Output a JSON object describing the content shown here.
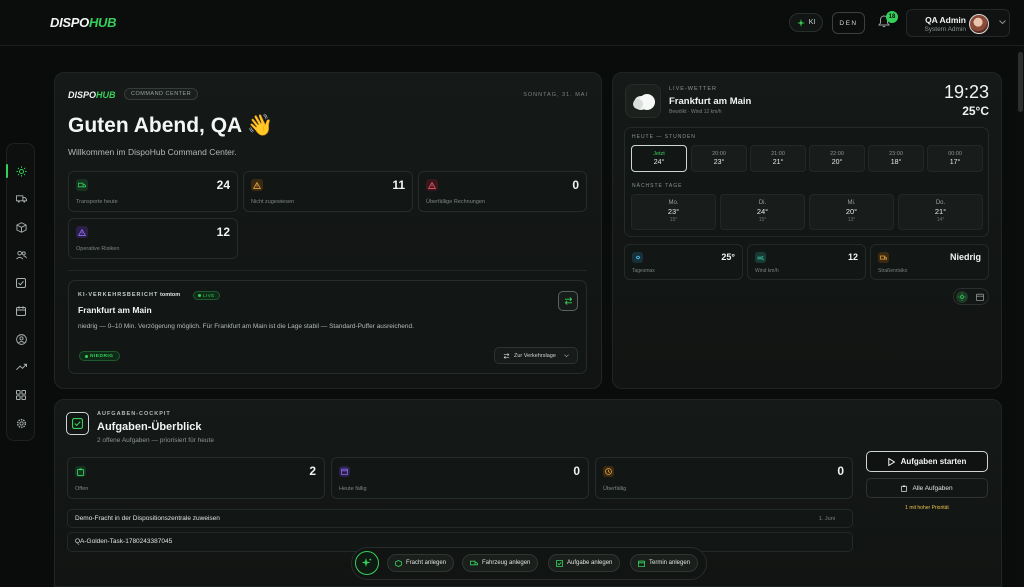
{
  "app": {
    "logo_a": "DISPO",
    "logo_b": "HUB"
  },
  "topbar": {
    "ki_label": "KI",
    "lang_label": "DEN",
    "notif_count": "18",
    "user_name": "QA Admin",
    "user_role": "System Admin"
  },
  "command_center": {
    "logo_a": "DISPO",
    "logo_b": "HUB",
    "badge": "COMMAND CENTER",
    "date": "SONNTAG, 31. MAI",
    "greeting": "Guten Abend, QA 👋",
    "welcome": "Willkommen im DispoHub Command Center.",
    "stats": [
      {
        "label": "Transporte heute",
        "value": "24",
        "icon": "truck-icon"
      },
      {
        "label": "Nicht zugewiesen",
        "value": "11",
        "icon": "warning-icon"
      },
      {
        "label": "Überfällige Rechnungen",
        "value": "0",
        "icon": "alert-icon"
      },
      {
        "label": "Operative Risiken",
        "value": "12",
        "icon": "risk-icon"
      }
    ],
    "traffic": {
      "heading": "KI-VERKEHRSBERICHT",
      "source": "tomtom",
      "live": "LIVE",
      "title": "Frankfurt am Main",
      "text": "niedrig — 0–10 Min. Verzögerung möglich. Für Frankfurt am Main ist die Lage stabil — Standard-Puffer ausreichend.",
      "level": "NIEDRIG",
      "link": "Zur Verkehrslage"
    }
  },
  "weather": {
    "tag": "LIVE-WETTER",
    "city": "Frankfurt am Main",
    "sub": "Bewölkt · Wind 12 km/h",
    "time": "19:23",
    "temp": "25°C",
    "hours_title": "HEUTE — STUNDEN",
    "hours": [
      {
        "t": "Jetzt",
        "v": "24°"
      },
      {
        "t": "20:00",
        "v": "23°"
      },
      {
        "t": "21:00",
        "v": "21°"
      },
      {
        "t": "22:00",
        "v": "20°"
      },
      {
        "t": "23:00",
        "v": "18°"
      },
      {
        "t": "00:00",
        "v": "17°"
      }
    ],
    "days_title": "NÄCHSTE TAGE",
    "days": [
      {
        "n": "Mo.",
        "hi": "23°",
        "lo": "15°"
      },
      {
        "n": "Di.",
        "hi": "24°",
        "lo": "15°"
      },
      {
        "n": "Mi.",
        "hi": "20°",
        "lo": "13°"
      },
      {
        "n": "Do.",
        "hi": "21°",
        "lo": "14°"
      }
    ],
    "stats": [
      {
        "label": "Tagesmax",
        "value": "25°"
      },
      {
        "label": "Wind km/h",
        "value": "12"
      },
      {
        "label": "Straßenrisiko",
        "value": "Niedrig"
      }
    ]
  },
  "tasks": {
    "tag": "AUFGABEN-COCKPIT",
    "title": "Aufgaben-Überblick",
    "subtitle": "2 offene Aufgaben — priorisiert für heute",
    "stats": [
      {
        "label": "Offen",
        "value": "2"
      },
      {
        "label": "Heute fällig",
        "value": "0"
      },
      {
        "label": "Überfällig",
        "value": "0"
      }
    ],
    "rows": [
      {
        "label": "Demo-Fracht in der Dispositionszentrale zuweisen",
        "date": "1. Juni"
      },
      {
        "label": "QA-Golden-Task-1780243387045",
        "date": ""
      }
    ],
    "start_label": "Aufgaben starten",
    "all_label": "Alle Aufgaben",
    "prio_note": "1 mit hoher Priorität"
  },
  "quickbar": [
    {
      "label": "Fracht anlegen"
    },
    {
      "label": "Fahrzeug anlegen"
    },
    {
      "label": "Aufgabe anlegen"
    },
    {
      "label": "Termin anlegen"
    }
  ],
  "colors": {
    "accent": "#35d05a",
    "warning": "#e6a23c",
    "danger": "#e05561",
    "purple": "#8b6cf0"
  }
}
